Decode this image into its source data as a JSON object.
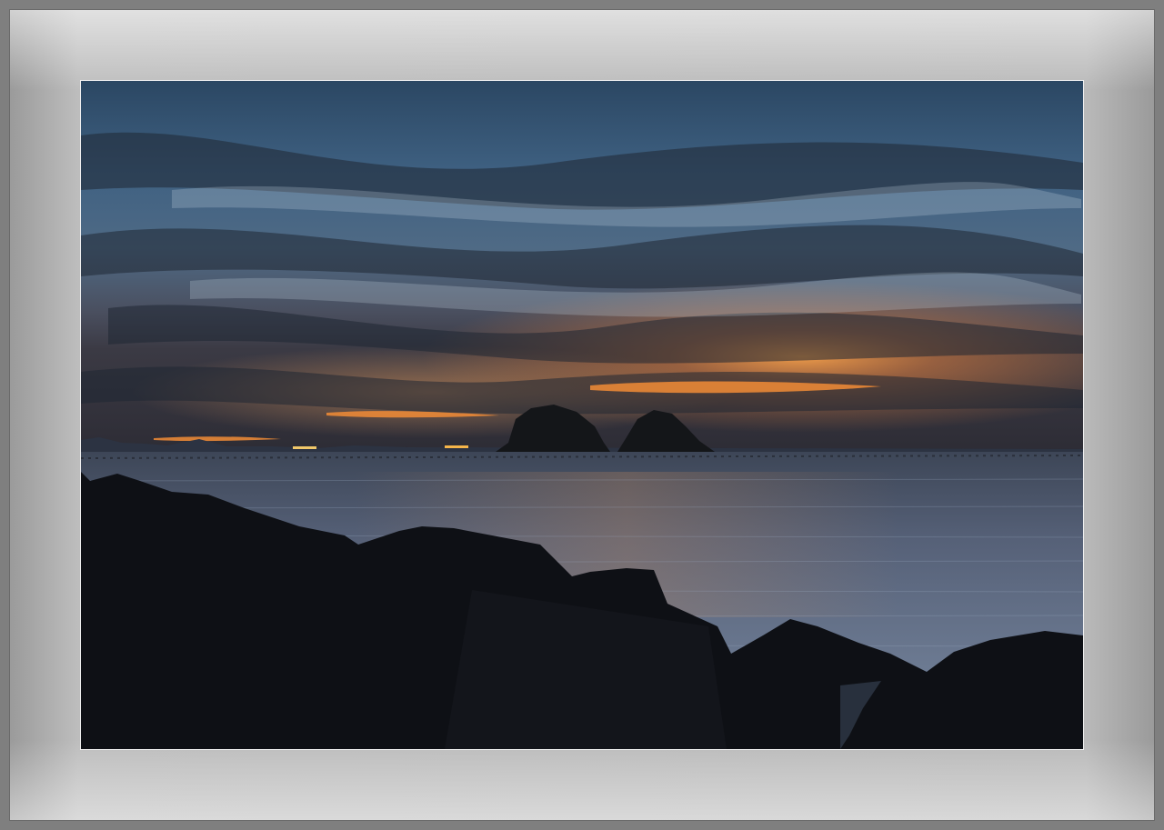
{
  "image": {
    "subject": "seascape-sunset",
    "colors": {
      "sky_top": "#2d4a66",
      "sky_mid": "#4c6c8c",
      "sunset_glow": "#f08a34",
      "horizon_band": "#c9643a",
      "sea": "#56657c",
      "rocks": "#0d0f14",
      "mat": "#bcbcbc",
      "frame": "#7f7f7f"
    }
  }
}
